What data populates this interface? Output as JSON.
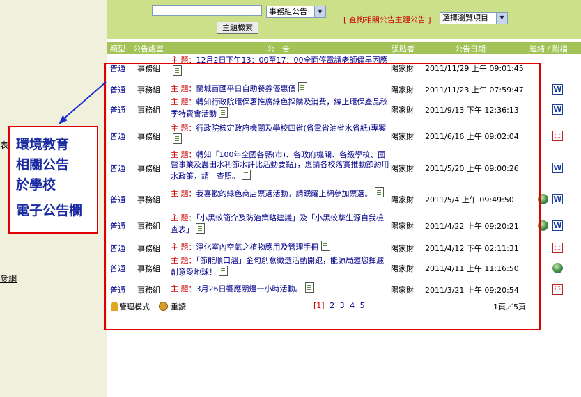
{
  "left_stubs": [
    "表",
    "參網"
  ],
  "search": {
    "value": "",
    "placeholder": ""
  },
  "dept_select": "事務組公告",
  "search_button": "主題檢索",
  "related_link": "[ 查詢相關公告主題公告 ]",
  "browse_select": "選擇瀏覽項目",
  "columns": [
    "類型",
    "公告處室",
    "公　告",
    "張貼者",
    "公告日期",
    "連結 / 附檔"
  ],
  "subject_label": "主 題：",
  "rows": [
    {
      "type": "普通",
      "dept": "事務組",
      "subject": "12月2日下午13：00至17：00全面停電請老師儘早因應",
      "poster": "陽家財",
      "date": "2011/11/29 上午 09:01:45",
      "attachments": []
    },
    {
      "type": "普通",
      "dept": "事務組",
      "subject": "蘭城百匯平日自助餐券優惠價",
      "poster": "陽家財",
      "date": "2011/11/23 上午 07:59:47",
      "attachments": [
        "word"
      ]
    },
    {
      "type": "普通",
      "dept": "事務組",
      "subject": "轉知行政院環保署推廣綠色採購及消費，線上環保產品秋季特賣會活動",
      "poster": "陽家財",
      "date": "2011/9/13 下午 12:36:13",
      "attachments": [
        "word"
      ]
    },
    {
      "type": "普通",
      "dept": "事務組",
      "subject": "行政院核定政府機關及學校四省(省電省油省水省紙)專案",
      "poster": "陽家財",
      "date": "2011/6/16 上午 09:02:04",
      "attachments": [
        "pdf"
      ]
    },
    {
      "type": "普通",
      "dept": "事務組",
      "subject": "轉知「100年全國各縣(市)、各政府機關、各級學校、國營事業及農田水利節水評比活動要點」，惠請各校落實推動節約用水政策，請　查照。",
      "poster": "陽家財",
      "date": "2011/5/20 上午 09:00:26",
      "attachments": [
        "word"
      ]
    },
    {
      "type": "普通",
      "dept": "事務組",
      "subject": "我喜歡的綠色商店票選活動，請踴躍上網參加票選。",
      "poster": "陽家財",
      "date": "2011/5/4 上午 09:49:50",
      "attachments": [
        "link",
        "word"
      ]
    },
    {
      "type": "普通",
      "dept": "事務組",
      "subject": "「小黑蚊簡介及防治策略建議」及「小黑蚊孳生源自我檢查表」",
      "poster": "陽家財",
      "date": "2011/4/22 上午 09:20:21",
      "attachments": [
        "link",
        "word"
      ]
    },
    {
      "type": "普通",
      "dept": "事務組",
      "subject": "淨化室內空氣之植物應用及管理手冊",
      "poster": "陽家財",
      "date": "2011/4/12 下午 02:11:31",
      "attachments": [
        "pdf"
      ]
    },
    {
      "type": "普通",
      "dept": "事務組",
      "subject": "「節能順口溜」金句創意徵選活動開跑，能源局邀您揮灑創意愛地球！",
      "poster": "陽家財",
      "date": "2011/4/11 上午 11:16:50",
      "attachments": [
        "link"
      ]
    },
    {
      "type": "普通",
      "dept": "事務組",
      "subject": "3月26日響應關燈一小時活動。",
      "poster": "陽家財",
      "date": "2011/3/21 上午 09:20:54",
      "attachments": [
        "pdf"
      ]
    }
  ],
  "footer": {
    "admin": "管理模式",
    "reload": "重讀",
    "pages": [
      "[1]",
      "2",
      "3",
      "4",
      "5"
    ],
    "page_count": "1頁／5頁"
  },
  "callout": [
    "環境教育",
    "相關公告",
    "於學校",
    "電子公告欄"
  ],
  "colors": {
    "top_bar": "#cce08a",
    "header": "#a3c257",
    "highlight": "#e00000",
    "callout_text": "#1a2aa0"
  }
}
